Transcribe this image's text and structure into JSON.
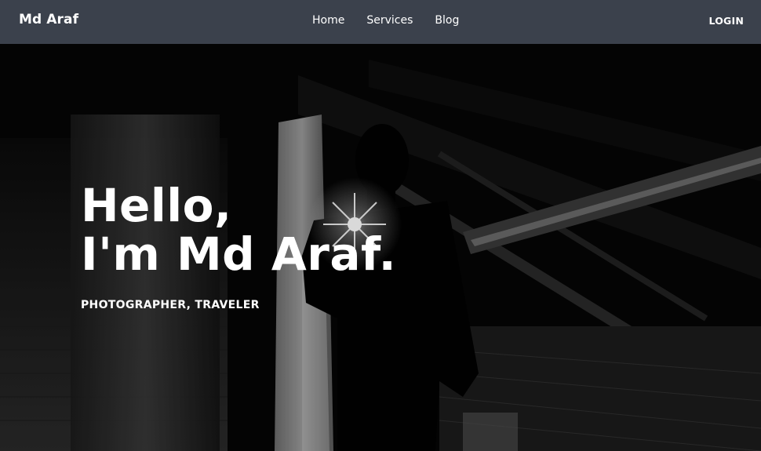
{
  "nav": {
    "brand": "Md Araf",
    "links": [
      "Home",
      "Services",
      "Blog"
    ],
    "login": "LOGIN"
  },
  "hero": {
    "line1": "Hello,",
    "line2": "I'm Md Araf.",
    "subtitle": "PHOTOGRAPHER, TRAVELER"
  },
  "colors": {
    "navbar_bg": "#3b414c",
    "text": "#ffffff",
    "hero_bg": "#050505"
  }
}
